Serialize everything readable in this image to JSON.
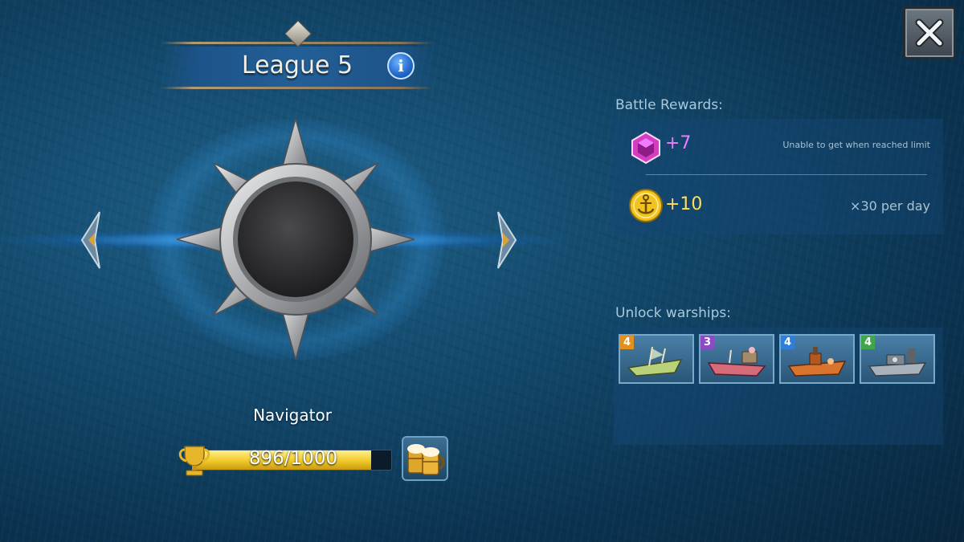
{
  "window": {
    "close_icon": "close-x-icon"
  },
  "league": {
    "title": "League 5",
    "info_icon": "info-icon"
  },
  "rank": {
    "name": "Navigator",
    "badge_icon": "compass-star-badge-icon"
  },
  "progress": {
    "current": "896",
    "separator": "/",
    "max": "1000",
    "fraction": 0.896,
    "icon": "trophy-icon"
  },
  "actions": {
    "beer_icon": "beer-mugs-icon"
  },
  "battle_rewards": {
    "label": "Battle Rewards:",
    "items": [
      {
        "icon": "pink-gem-icon",
        "amount": "+7",
        "note": "Unable to get when reached limit"
      },
      {
        "icon": "gold-anchor-coin-icon",
        "amount": "+10",
        "note": "×30 per day"
      }
    ]
  },
  "unlock_warships": {
    "label": "Unlock warships:",
    "ships": [
      {
        "level": "4",
        "level_color": "#e2921c",
        "icon": "green-warship-icon"
      },
      {
        "level": "3",
        "level_color": "#8b4bc4",
        "icon": "pink-warship-icon"
      },
      {
        "level": "4",
        "level_color": "#2f7fd8",
        "icon": "orange-warship-icon"
      },
      {
        "level": "4",
        "level_color": "#3fa64a",
        "icon": "silver-warship-icon"
      }
    ]
  },
  "colors": {
    "accent_glow": "#46aaff",
    "gem_text": "#f07bff",
    "coin_text": "#ffdf5a",
    "progress_fill": "#f0c928"
  }
}
